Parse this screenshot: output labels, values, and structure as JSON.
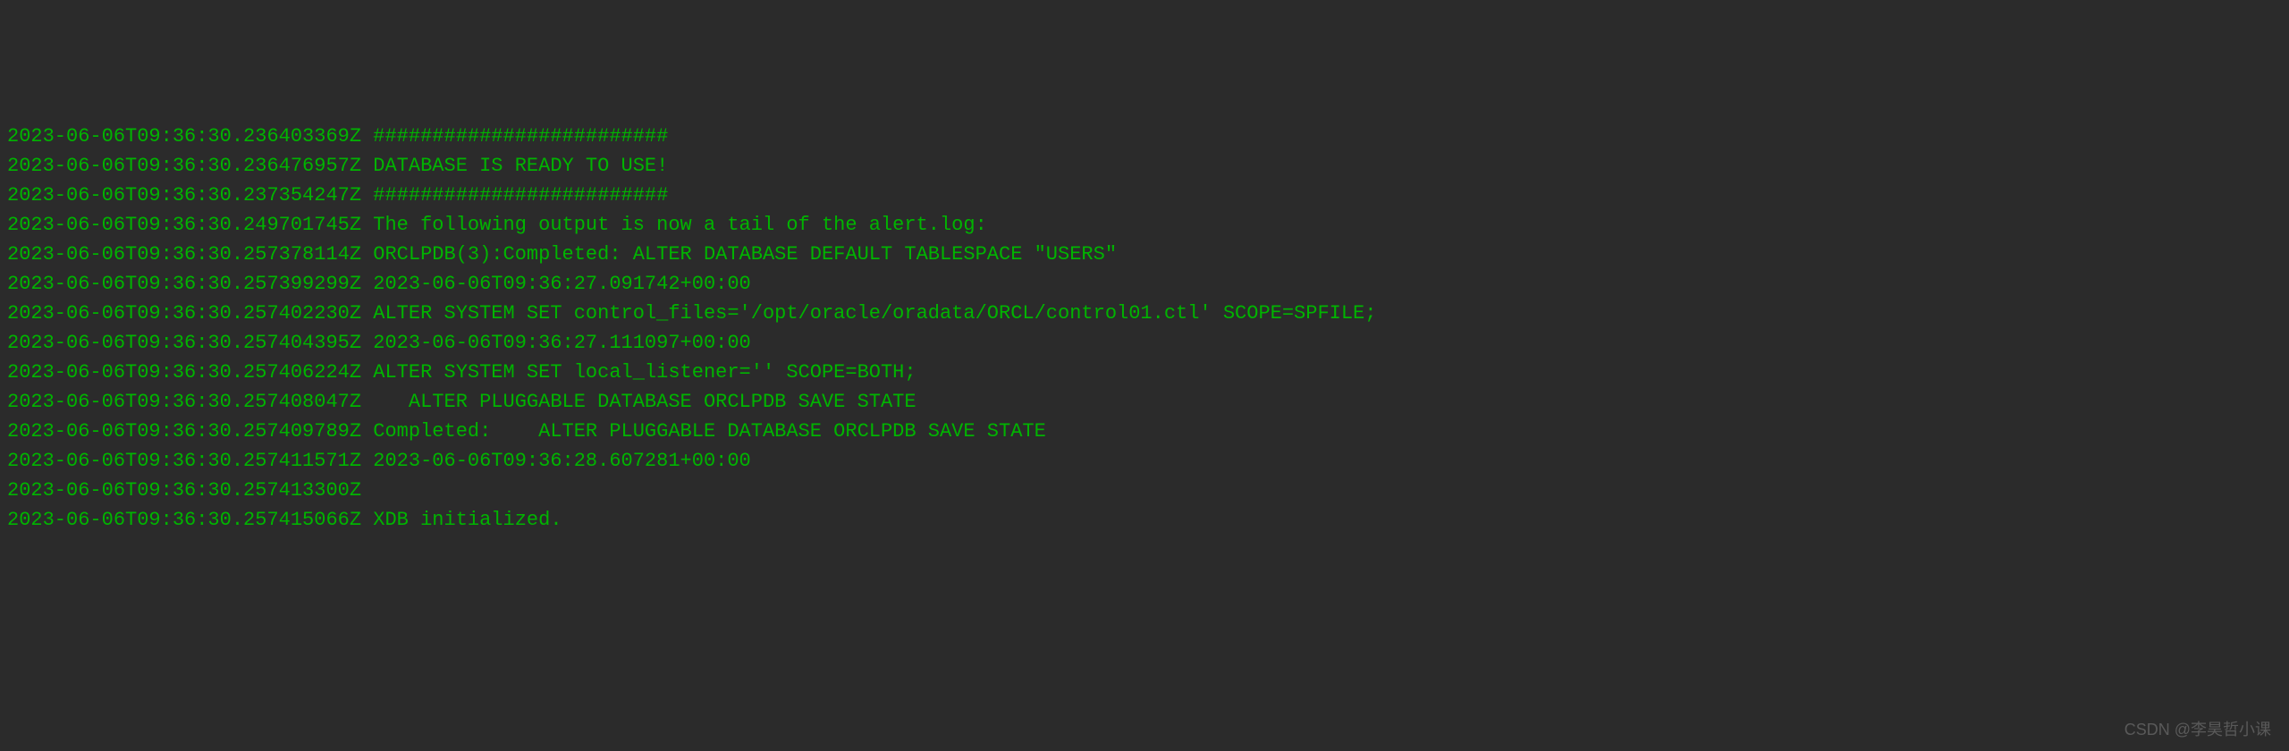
{
  "log_lines": [
    {
      "timestamp": "2023-06-06T09:36:30.236403369Z",
      "message": "#########################"
    },
    {
      "timestamp": "2023-06-06T09:36:30.236476957Z",
      "message": "DATABASE IS READY TO USE!"
    },
    {
      "timestamp": "2023-06-06T09:36:30.237354247Z",
      "message": "#########################"
    },
    {
      "timestamp": "2023-06-06T09:36:30.249701745Z",
      "message": "The following output is now a tail of the alert.log:"
    },
    {
      "timestamp": "2023-06-06T09:36:30.257378114Z",
      "message": "ORCLPDB(3):Completed: ALTER DATABASE DEFAULT TABLESPACE \"USERS\""
    },
    {
      "timestamp": "2023-06-06T09:36:30.257399299Z",
      "message": "2023-06-06T09:36:27.091742+00:00"
    },
    {
      "timestamp": "2023-06-06T09:36:30.257402230Z",
      "message": "ALTER SYSTEM SET control_files='/opt/oracle/oradata/ORCL/control01.ctl' SCOPE=SPFILE;"
    },
    {
      "timestamp": "2023-06-06T09:36:30.257404395Z",
      "message": "2023-06-06T09:36:27.111097+00:00"
    },
    {
      "timestamp": "2023-06-06T09:36:30.257406224Z",
      "message": "ALTER SYSTEM SET local_listener='' SCOPE=BOTH;"
    },
    {
      "timestamp": "2023-06-06T09:36:30.257408047Z",
      "message": "   ALTER PLUGGABLE DATABASE ORCLPDB SAVE STATE"
    },
    {
      "timestamp": "2023-06-06T09:36:30.257409789Z",
      "message": "Completed:    ALTER PLUGGABLE DATABASE ORCLPDB SAVE STATE"
    },
    {
      "timestamp": "2023-06-06T09:36:30.257411571Z",
      "message": "2023-06-06T09:36:28.607281+00:00"
    },
    {
      "timestamp": "2023-06-06T09:36:30.257413300Z",
      "message": ""
    },
    {
      "timestamp": "2023-06-06T09:36:30.257415066Z",
      "message": "XDB initialized."
    }
  ],
  "watermark": "CSDN @李昊哲小课"
}
